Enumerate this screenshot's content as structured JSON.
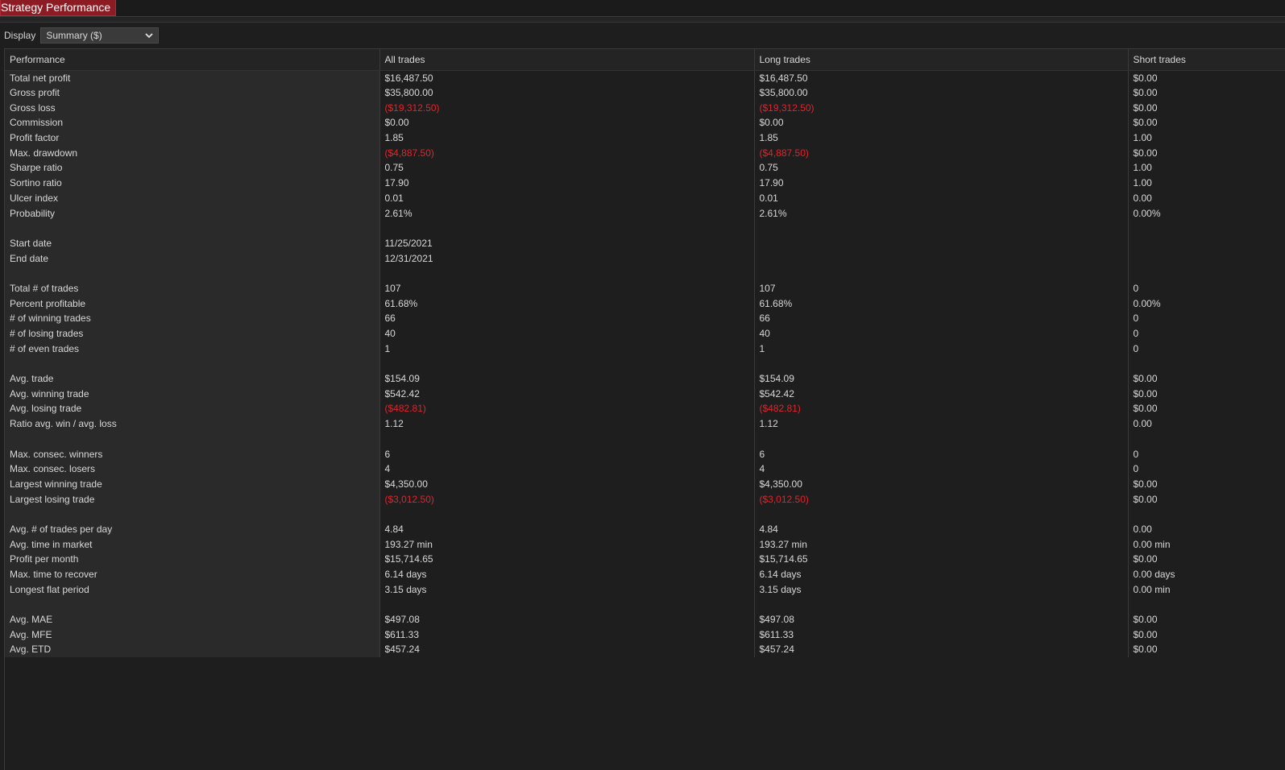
{
  "window": {
    "title": "Strategy Performance"
  },
  "display": {
    "label": "Display",
    "selected": "Summary ($)"
  },
  "colors": {
    "title_tab_bg": "#8d1b24",
    "negative_value": "#e0242c",
    "background": "#1e1e1e"
  },
  "table": {
    "columns": [
      "Performance",
      "All trades",
      "Long trades",
      "Short trades"
    ],
    "rows": [
      {
        "label": "Total net profit",
        "all": "$16,487.50",
        "long": "$16,487.50",
        "short": "$0.00"
      },
      {
        "label": "Gross profit",
        "all": "$35,800.00",
        "long": "$35,800.00",
        "short": "$0.00"
      },
      {
        "label": "Gross loss",
        "all": "($19,312.50)",
        "long": "($19,312.50)",
        "short": "$0.00",
        "neg": true
      },
      {
        "label": "Commission",
        "all": "$0.00",
        "long": "$0.00",
        "short": "$0.00"
      },
      {
        "label": "Profit factor",
        "all": "1.85",
        "long": "1.85",
        "short": "1.00"
      },
      {
        "label": "Max. drawdown",
        "all": "($4,887.50)",
        "long": "($4,887.50)",
        "short": "$0.00",
        "neg": true
      },
      {
        "label": "Sharpe ratio",
        "all": "0.75",
        "long": "0.75",
        "short": "1.00"
      },
      {
        "label": "Sortino ratio",
        "all": "17.90",
        "long": "17.90",
        "short": "1.00"
      },
      {
        "label": "Ulcer index",
        "all": "0.01",
        "long": "0.01",
        "short": "0.00"
      },
      {
        "label": "Probability",
        "all": "2.61%",
        "long": "2.61%",
        "short": "0.00%"
      },
      {
        "label": "",
        "all": "",
        "long": "",
        "short": ""
      },
      {
        "label": "Start date",
        "all": "11/25/2021",
        "long": "",
        "short": ""
      },
      {
        "label": "End date",
        "all": "12/31/2021",
        "long": "",
        "short": ""
      },
      {
        "label": "",
        "all": "",
        "long": "",
        "short": ""
      },
      {
        "label": "Total # of trades",
        "all": "107",
        "long": "107",
        "short": "0"
      },
      {
        "label": "Percent profitable",
        "all": "61.68%",
        "long": "61.68%",
        "short": "0.00%"
      },
      {
        "label": "# of winning trades",
        "all": "66",
        "long": "66",
        "short": "0"
      },
      {
        "label": "# of losing trades",
        "all": "40",
        "long": "40",
        "short": "0"
      },
      {
        "label": "# of even trades",
        "all": "1",
        "long": "1",
        "short": "0"
      },
      {
        "label": "",
        "all": "",
        "long": "",
        "short": ""
      },
      {
        "label": "Avg. trade",
        "all": "$154.09",
        "long": "$154.09",
        "short": "$0.00"
      },
      {
        "label": "Avg. winning trade",
        "all": "$542.42",
        "long": "$542.42",
        "short": "$0.00"
      },
      {
        "label": "Avg. losing trade",
        "all": "($482.81)",
        "long": "($482.81)",
        "short": "$0.00",
        "neg": true
      },
      {
        "label": "Ratio avg. win / avg. loss",
        "all": "1.12",
        "long": "1.12",
        "short": "0.00"
      },
      {
        "label": "",
        "all": "",
        "long": "",
        "short": ""
      },
      {
        "label": "Max. consec. winners",
        "all": "6",
        "long": "6",
        "short": "0"
      },
      {
        "label": "Max. consec. losers",
        "all": "4",
        "long": "4",
        "short": "0"
      },
      {
        "label": "Largest winning trade",
        "all": "$4,350.00",
        "long": "$4,350.00",
        "short": "$0.00"
      },
      {
        "label": "Largest losing trade",
        "all": "($3,012.50)",
        "long": "($3,012.50)",
        "short": "$0.00",
        "neg": true
      },
      {
        "label": "",
        "all": "",
        "long": "",
        "short": ""
      },
      {
        "label": "Avg. # of trades per day",
        "all": "4.84",
        "long": "4.84",
        "short": "0.00"
      },
      {
        "label": "Avg. time in market",
        "all": "193.27 min",
        "long": "193.27 min",
        "short": "0.00 min"
      },
      {
        "label": "Profit per month",
        "all": "$15,714.65",
        "long": "$15,714.65",
        "short": "$0.00"
      },
      {
        "label": "Max. time to recover",
        "all": "6.14 days",
        "long": "6.14 days",
        "short": "0.00 days"
      },
      {
        "label": "Longest flat period",
        "all": "3.15 days",
        "long": "3.15 days",
        "short": "0.00 min"
      },
      {
        "label": "",
        "all": "",
        "long": "",
        "short": ""
      },
      {
        "label": "Avg. MAE",
        "all": "$497.08",
        "long": "$497.08",
        "short": "$0.00"
      },
      {
        "label": "Avg. MFE",
        "all": "$611.33",
        "long": "$611.33",
        "short": "$0.00"
      },
      {
        "label": "Avg. ETD",
        "all": "$457.24",
        "long": "$457.24",
        "short": "$0.00"
      }
    ]
  }
}
